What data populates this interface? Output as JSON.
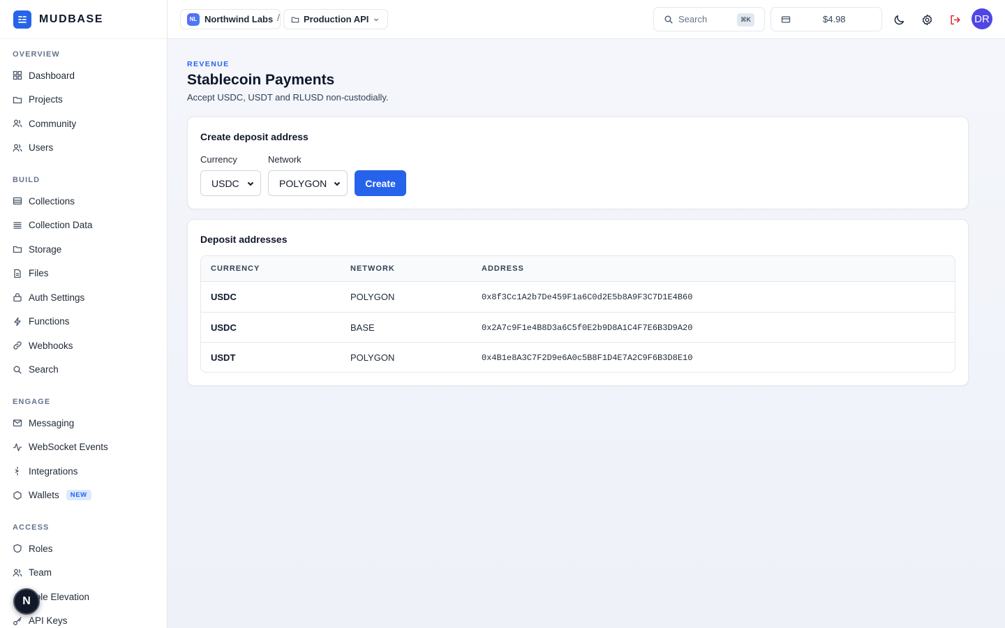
{
  "brand": {
    "name": "MUDBASE"
  },
  "sidebar": {
    "sections": [
      {
        "title": "OVERVIEW",
        "items": [
          {
            "label": "Dashboard",
            "icon": "grid-icon"
          },
          {
            "label": "Projects",
            "icon": "folder-icon"
          },
          {
            "label": "Community",
            "icon": "users-icon"
          },
          {
            "label": "Users",
            "icon": "users-icon"
          }
        ]
      },
      {
        "title": "BUILD",
        "items": [
          {
            "label": "Collections",
            "icon": "database-icon"
          },
          {
            "label": "Collection Data",
            "icon": "list-icon"
          },
          {
            "label": "Storage",
            "icon": "folder-icon"
          },
          {
            "label": "Files",
            "icon": "file-icon"
          },
          {
            "label": "Auth Settings",
            "icon": "lock-icon"
          },
          {
            "label": "Functions",
            "icon": "bolt-icon"
          },
          {
            "label": "Webhooks",
            "icon": "link-icon"
          },
          {
            "label": "Search",
            "icon": "search-icon"
          }
        ]
      },
      {
        "title": "ENGAGE",
        "items": [
          {
            "label": "Messaging",
            "icon": "mail-icon"
          },
          {
            "label": "WebSocket Events",
            "icon": "activity-icon"
          },
          {
            "label": "Integrations",
            "icon": "sparkle-icon"
          },
          {
            "label": "Wallets",
            "icon": "hexagon-icon",
            "badge": "NEW"
          }
        ]
      },
      {
        "title": "ACCESS",
        "items": [
          {
            "label": "Roles",
            "icon": "shield-icon"
          },
          {
            "label": "Team",
            "icon": "users-icon"
          },
          {
            "label": "Role Elevation",
            "icon": "arrow-up-icon"
          },
          {
            "label": "API Keys",
            "icon": "key-icon"
          }
        ]
      }
    ],
    "floating_button": "N"
  },
  "topbar": {
    "org_initials": "NL",
    "org_name": "Northwind Labs",
    "separator": "/",
    "project_name": "Production API",
    "search_placeholder": "Search",
    "search_shortcut": "⌘K",
    "credit_amount": "$4.98",
    "user_initials": "DR"
  },
  "page": {
    "eyebrow": "REVENUE",
    "title": "Stablecoin Payments",
    "subtitle": "Accept USDC, USDT and RLUSD non-custodially."
  },
  "create_card": {
    "title": "Create deposit address",
    "currency_label": "Currency",
    "currency_value": "USDC",
    "network_label": "Network",
    "network_value": "POLYGON",
    "create_label": "Create"
  },
  "addresses_card": {
    "title": "Deposit addresses",
    "columns": [
      "CURRENCY",
      "NETWORK",
      "ADDRESS"
    ],
    "rows": [
      {
        "currency": "USDC",
        "network": "POLYGON",
        "address": "0x8f3Cc1A2b7De459F1a6C0d2E5b8A9F3C7D1E4B60"
      },
      {
        "currency": "USDC",
        "network": "BASE",
        "address": "0x2A7c9F1e4B8D3a6C5f0E2b9D8A1C4F7E6B3D9A20"
      },
      {
        "currency": "USDT",
        "network": "POLYGON",
        "address": "0x4B1e8A3C7F2D9e6A0c5B8F1D4E7A2C9F6B3D8E10"
      }
    ]
  },
  "colors": {
    "accent": "#2563eb",
    "avatar": "#4f46e5",
    "logout": "#dc2626"
  }
}
